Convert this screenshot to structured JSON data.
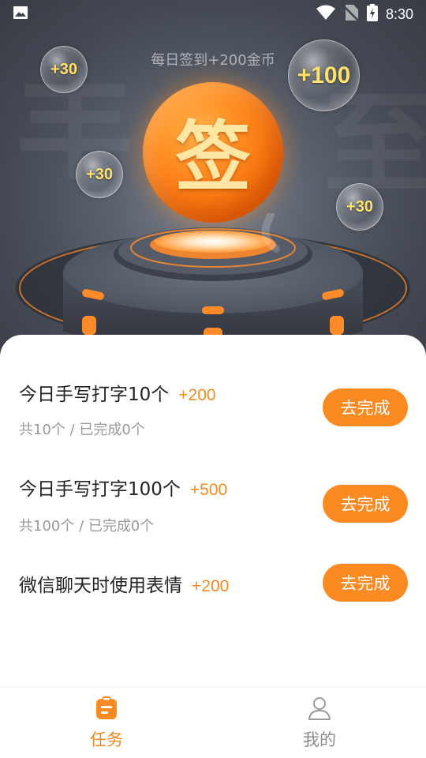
{
  "status_bar": {
    "time": "8:30",
    "icons": [
      "image-icon",
      "wifi-icon",
      "no-sim-icon",
      "battery-charging-icon"
    ]
  },
  "hero": {
    "daily_text": "每日签到+200金币",
    "sign_char": "签",
    "bubbles": [
      "+30",
      "+100",
      "+30",
      "+30"
    ]
  },
  "tasks": [
    {
      "title": "今日手写打字10个",
      "reward": "+200",
      "sub": "共10个 / 已完成0个",
      "button": "去完成"
    },
    {
      "title": "今日手写打字100个",
      "reward": "+500",
      "sub": "共100个 / 已完成0个",
      "button": "去完成"
    },
    {
      "title": "微信聊天时使用表情",
      "reward": "+200",
      "button": "去完成"
    }
  ],
  "nav": {
    "items": [
      {
        "label": "任务",
        "icon": "clipboard-icon",
        "active": true
      },
      {
        "label": "我的",
        "icon": "person-icon",
        "active": false
      }
    ]
  },
  "colors": {
    "accent": "#fb8a22",
    "reward": "#f28a1f",
    "bubble_text": "#ffe26a"
  }
}
